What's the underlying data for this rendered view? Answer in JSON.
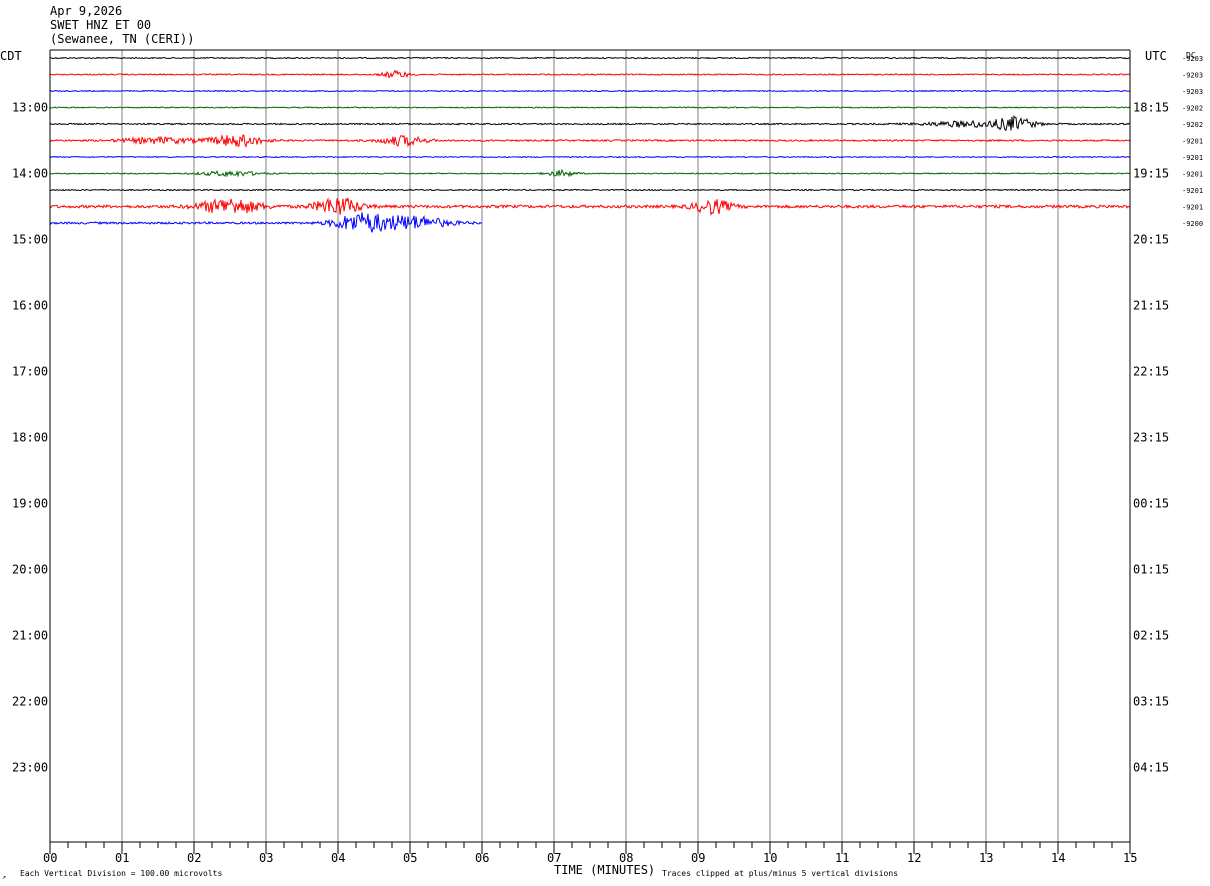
{
  "header": {
    "date": "Apr 9,2026",
    "station": "SWET HNZ ET 00",
    "location": "(Sewanee, TN (CERI))"
  },
  "chart_data": {
    "type": "line",
    "left_axis_label": "CDT",
    "right_axis_label": "UTC",
    "right_dc_label": "DC",
    "xlabel": "TIME (MINUTES)",
    "x_ticks": [
      "00",
      "01",
      "02",
      "03",
      "04",
      "05",
      "06",
      "07",
      "08",
      "09",
      "10",
      "11",
      "12",
      "13",
      "14",
      "15"
    ],
    "xlim": [
      0,
      15
    ],
    "minor_ticks_per_minute": 4,
    "row_count": 48,
    "rows_per_hour": 4,
    "first_row_time_cdt": "12:15",
    "left_hour_labels": [
      "13:00",
      "14:00",
      "15:00",
      "16:00",
      "17:00",
      "18:00",
      "19:00",
      "20:00",
      "21:00",
      "22:00",
      "23:00"
    ],
    "right_hour_labels": [
      "18:15",
      "19:15",
      "20:15",
      "21:15",
      "22:15",
      "23:15",
      "00:15",
      "01:15",
      "02:15",
      "03:15",
      "04:15"
    ],
    "trace_colors": [
      "#000000",
      "#ff0000",
      "#0000ff",
      "#006400"
    ],
    "traces": [
      {
        "dc": "-9203",
        "end_min": 15,
        "events": [],
        "noise": 0.6
      },
      {
        "dc": "-9203",
        "end_min": 15,
        "events": [
          {
            "t": 4.8,
            "w": 0.18,
            "a": 3.5
          }
        ],
        "noise": 0.6
      },
      {
        "dc": "-9203",
        "end_min": 15,
        "events": [],
        "noise": 0.5
      },
      {
        "dc": "-9202",
        "end_min": 15,
        "events": [],
        "noise": 0.5
      },
      {
        "dc": "-9202",
        "end_min": 15,
        "events": [
          {
            "t": 12.8,
            "w": 0.6,
            "a": 3
          },
          {
            "t": 13.4,
            "w": 0.25,
            "a": 6
          }
        ],
        "noise": 0.7
      },
      {
        "dc": "-9201",
        "end_min": 15,
        "events": [
          {
            "t": 1.5,
            "w": 0.5,
            "a": 3
          },
          {
            "t": 2.6,
            "w": 0.35,
            "a": 6
          },
          {
            "t": 4.9,
            "w": 0.3,
            "a": 5
          }
        ],
        "noise": 0.8
      },
      {
        "dc": "-9201",
        "end_min": 15,
        "events": [],
        "noise": 0.5
      },
      {
        "dc": "-9201",
        "end_min": 15,
        "events": [
          {
            "t": 2.5,
            "w": 0.4,
            "a": 2.5
          },
          {
            "t": 7.1,
            "w": 0.2,
            "a": 3
          }
        ],
        "noise": 0.5
      },
      {
        "dc": "-9201",
        "end_min": 15,
        "events": [],
        "noise": 0.6
      },
      {
        "dc": "-9201",
        "end_min": 15,
        "events": [
          {
            "t": 2.5,
            "w": 0.4,
            "a": 8
          },
          {
            "t": 4.0,
            "w": 0.3,
            "a": 9
          },
          {
            "t": 9.2,
            "w": 0.25,
            "a": 7
          }
        ],
        "noise": 1.4
      },
      {
        "dc": "-9200",
        "end_min": 6,
        "events": [
          {
            "t": 4.3,
            "w": 0.35,
            "a": 9
          },
          {
            "t": 5.0,
            "w": 0.5,
            "a": 7
          }
        ],
        "noise": 1.0
      }
    ],
    "footer_left": "Each Vertical Division =  100.00 microvolts",
    "footer_right": "Traces clipped at plus/minus 5 vertical divisions"
  }
}
